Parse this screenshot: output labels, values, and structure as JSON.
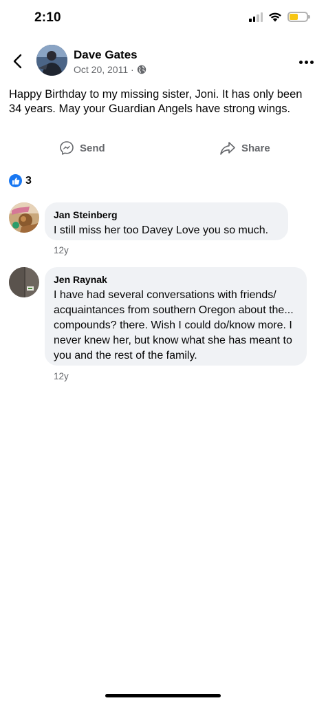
{
  "status_bar": {
    "time": "2:10",
    "icons": [
      "cellular-signal-icon",
      "wifi-icon",
      "battery-icon"
    ],
    "battery_color": "#f7c614"
  },
  "post": {
    "author": "Dave Gates",
    "date": "Oct 20, 2011 ·",
    "privacy_icon": "globe-icon",
    "text": "Happy Birthday to my missing sister,  Joni.  It has only been 34 years.  May your Guardian Angels have strong wings."
  },
  "actions": {
    "send_label": "Send",
    "share_label": "Share"
  },
  "reactions": {
    "icon": "like-icon",
    "count": "3",
    "color": "#1877f2"
  },
  "comments": [
    {
      "name": "Jan Steinberg",
      "text": "I still miss her too Davey Love you so much.",
      "time": "12y"
    },
    {
      "name": "Jen Raynak",
      "text": "I have had several conversations with friends/ acquaintances from southern Oregon about the... compounds? there. Wish I could do/know more. I never knew her, but know what she has meant to you and the rest of the family.",
      "time": "12y"
    }
  ]
}
